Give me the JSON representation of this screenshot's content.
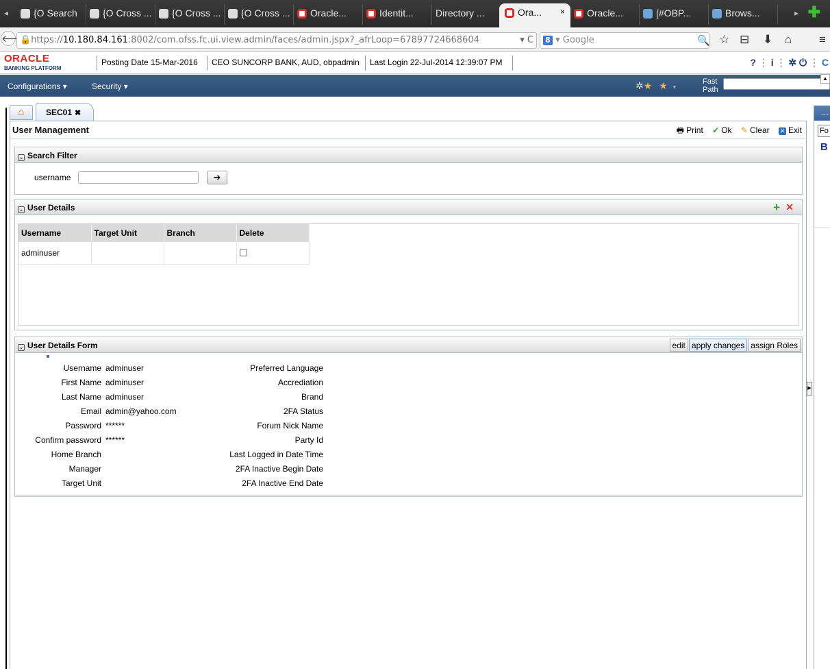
{
  "browser": {
    "tabs": [
      {
        "label": "{O Search",
        "fav": "grey"
      },
      {
        "label": "{O Cross ...",
        "fav": "grey"
      },
      {
        "label": "{O Cross ...",
        "fav": "grey"
      },
      {
        "label": "{O Cross ...",
        "fav": "grey"
      },
      {
        "label": "Oracle...",
        "fav": "red"
      },
      {
        "label": "Identit...",
        "fav": "red"
      },
      {
        "label": "Directory ...",
        "fav": "none"
      },
      {
        "label": "Ora...",
        "fav": "red",
        "active": true
      },
      {
        "label": "Oracle...",
        "fav": "red"
      },
      {
        "label": "[#OBP...",
        "fav": "person"
      },
      {
        "label": "Brows...",
        "fav": "person"
      }
    ],
    "active_tab_close": "×",
    "url_prefix": "https://",
    "url_host": "10.180.84.161",
    "url_rest": ":8002/com.ofss.fc.ui.view.admin/faces/admin.jspx?_afrLoop=67897724668604",
    "url_tail": "▾ C",
    "search_engine_label": "Google",
    "search_engine_glyph": "8"
  },
  "app": {
    "logo": "ORACLE",
    "logo_sub": "BANKING PLATFORM",
    "posting_date": "Posting Date 15-Mar-2016",
    "user_info": "CEO SUNCORP BANK, AUD, obpadmin",
    "last_login": "Last Login 22-Jul-2014 12:39:07 PM",
    "menus": [
      "Configurations",
      "Security"
    ],
    "fast_path_label_1": "Fast",
    "fast_path_label_2": "Path"
  },
  "content_tabs": {
    "active_tab": "SEC01"
  },
  "page": {
    "title": "User Management",
    "toolbar": {
      "print": "Print",
      "ok": "Ok",
      "clear": "Clear",
      "exit": "Exit"
    }
  },
  "search_filter": {
    "title": "Search Filter",
    "username_label": "username",
    "username_value": ""
  },
  "user_details": {
    "title": "User Details",
    "columns": [
      "Username",
      "Target Unit",
      "Branch",
      "Delete"
    ],
    "rows": [
      {
        "username": "adminuser",
        "target_unit": "",
        "branch": "",
        "delete": false
      }
    ]
  },
  "user_details_form": {
    "title": "User Details Form",
    "buttons": {
      "edit": "edit",
      "apply": "apply changes",
      "assign": "assign Roles"
    },
    "left_fields": [
      {
        "label": "Username",
        "value": "adminuser"
      },
      {
        "label": "First Name",
        "value": "adminuser"
      },
      {
        "label": "Last Name",
        "value": "adminuser"
      },
      {
        "label": "Email",
        "value": "admin@yahoo.com"
      },
      {
        "label": "Password",
        "value": "******"
      },
      {
        "label": "Confirm password",
        "value": "******"
      },
      {
        "label": "Home Branch",
        "value": ""
      },
      {
        "label": "Manager",
        "value": ""
      },
      {
        "label": "Target Unit",
        "value": ""
      }
    ],
    "right_fields": [
      {
        "label": "Preferred Language",
        "value": ""
      },
      {
        "label": "Accrediation",
        "value": ""
      },
      {
        "label": "Brand",
        "value": ""
      },
      {
        "label": "2FA Status",
        "value": ""
      },
      {
        "label": "Forum Nick Name",
        "value": ""
      },
      {
        "label": "Party Id",
        "value": ""
      },
      {
        "label": "Last Logged in Date Time",
        "value": ""
      },
      {
        "label": "2FA Inactive Begin Date",
        "value": ""
      },
      {
        "label": "2FA Inactive End Date",
        "value": ""
      }
    ]
  },
  "right_panel": {
    "header": "...",
    "box_text": "Fo",
    "letter": "B"
  },
  "colors": {
    "menubar": "#2b4c74",
    "oracle_red": "#e2211c",
    "accent_blue": "#1b3b78"
  }
}
